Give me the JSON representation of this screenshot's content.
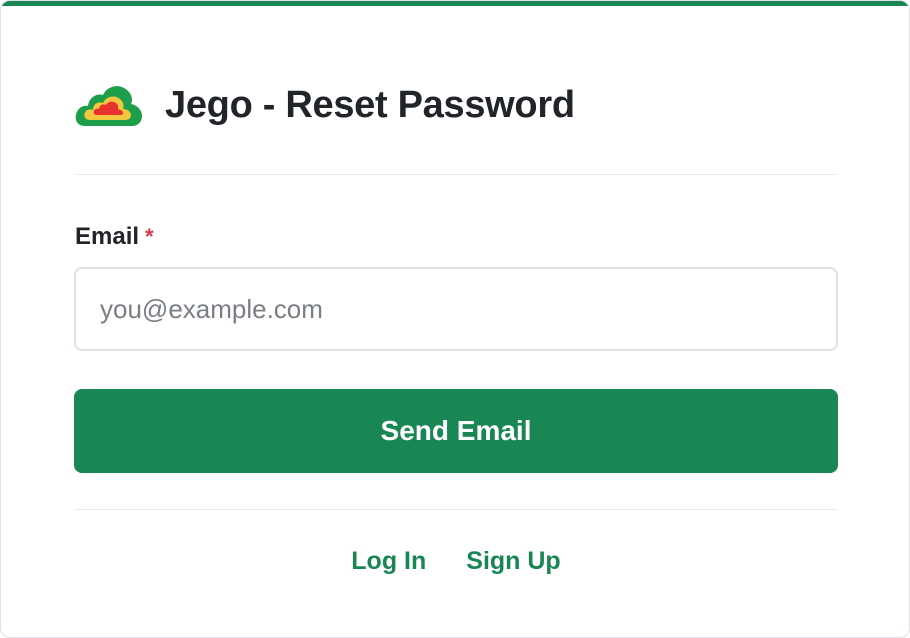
{
  "header": {
    "title": "Jego - Reset Password",
    "logo_icon": "cloud-logo-icon"
  },
  "form": {
    "email_label": "Email",
    "required_marker": "*",
    "email_value": "",
    "email_placeholder": "you@example.com",
    "submit_label": "Send Email"
  },
  "footer": {
    "login_label": "Log In",
    "signup_label": "Sign Up"
  },
  "colors": {
    "brand": "#198754",
    "required": "#dc3545",
    "logo_outer": "#1e9e4a",
    "logo_middle": "#f3c63f",
    "logo_inner": "#e8302f"
  }
}
